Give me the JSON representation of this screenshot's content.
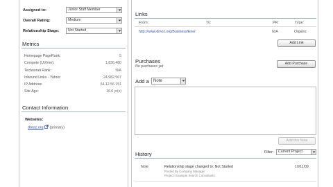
{
  "left": {
    "fields": {
      "assigned_to_label": "Assigned to:",
      "assigned_to_value": "Junior Staff Member",
      "rating_label": "Overall Rating:",
      "rating_value": "Medium",
      "stage_label": "Relationship Stage:",
      "stage_value": "Not Started"
    },
    "metrics": {
      "title": "Metrics",
      "rows": [
        {
          "key": "Homepage PageRank:",
          "value": "5"
        },
        {
          "key": "Compete (UV/mo):",
          "value": "1,836,480"
        },
        {
          "key": "Technorati Rank:",
          "value": "N/A"
        },
        {
          "key": "Inbound Links - Yahoo:",
          "value": "24,982,567"
        },
        {
          "key": "IP Address:",
          "value": "64.12.56.151"
        },
        {
          "key": "Site Age:",
          "value": "16.6 yr(s)"
        }
      ]
    },
    "contact": {
      "title": "Contact Information",
      "websites_label": "Websites:",
      "website_link": "dmoz.org",
      "website_suffix": "(primary)"
    }
  },
  "right": {
    "links": {
      "title": "Links",
      "headers": {
        "from": "From:",
        "to": "To:",
        "pr": "PR:",
        "type": "Type:"
      },
      "row": {
        "from": "http://www.dmoz.org/Business/Ener",
        "to": "",
        "pr": "N/A",
        "type": "Organic"
      },
      "add_button": "Add Link"
    },
    "purchases": {
      "title": "Purchases",
      "empty": "No purchases yet",
      "add_button": "Add Purchase"
    },
    "add_note": {
      "label": "Add a",
      "type_value": "Note",
      "button": "Add this Note"
    },
    "history": {
      "title": "History",
      "filter_label": "Filter:",
      "filter_value": "Current Project",
      "entry": {
        "type": "Note",
        "text": "Relationship stage changed to: Not Started",
        "meta1": "Posted By Company Manager",
        "meta2": "Project: Example Search Consultants",
        "date": "10/11/09"
      }
    }
  },
  "colors": {
    "rule": "#9fb3c8",
    "link": "#3355aa",
    "panel_border": "#c8c8c8"
  }
}
